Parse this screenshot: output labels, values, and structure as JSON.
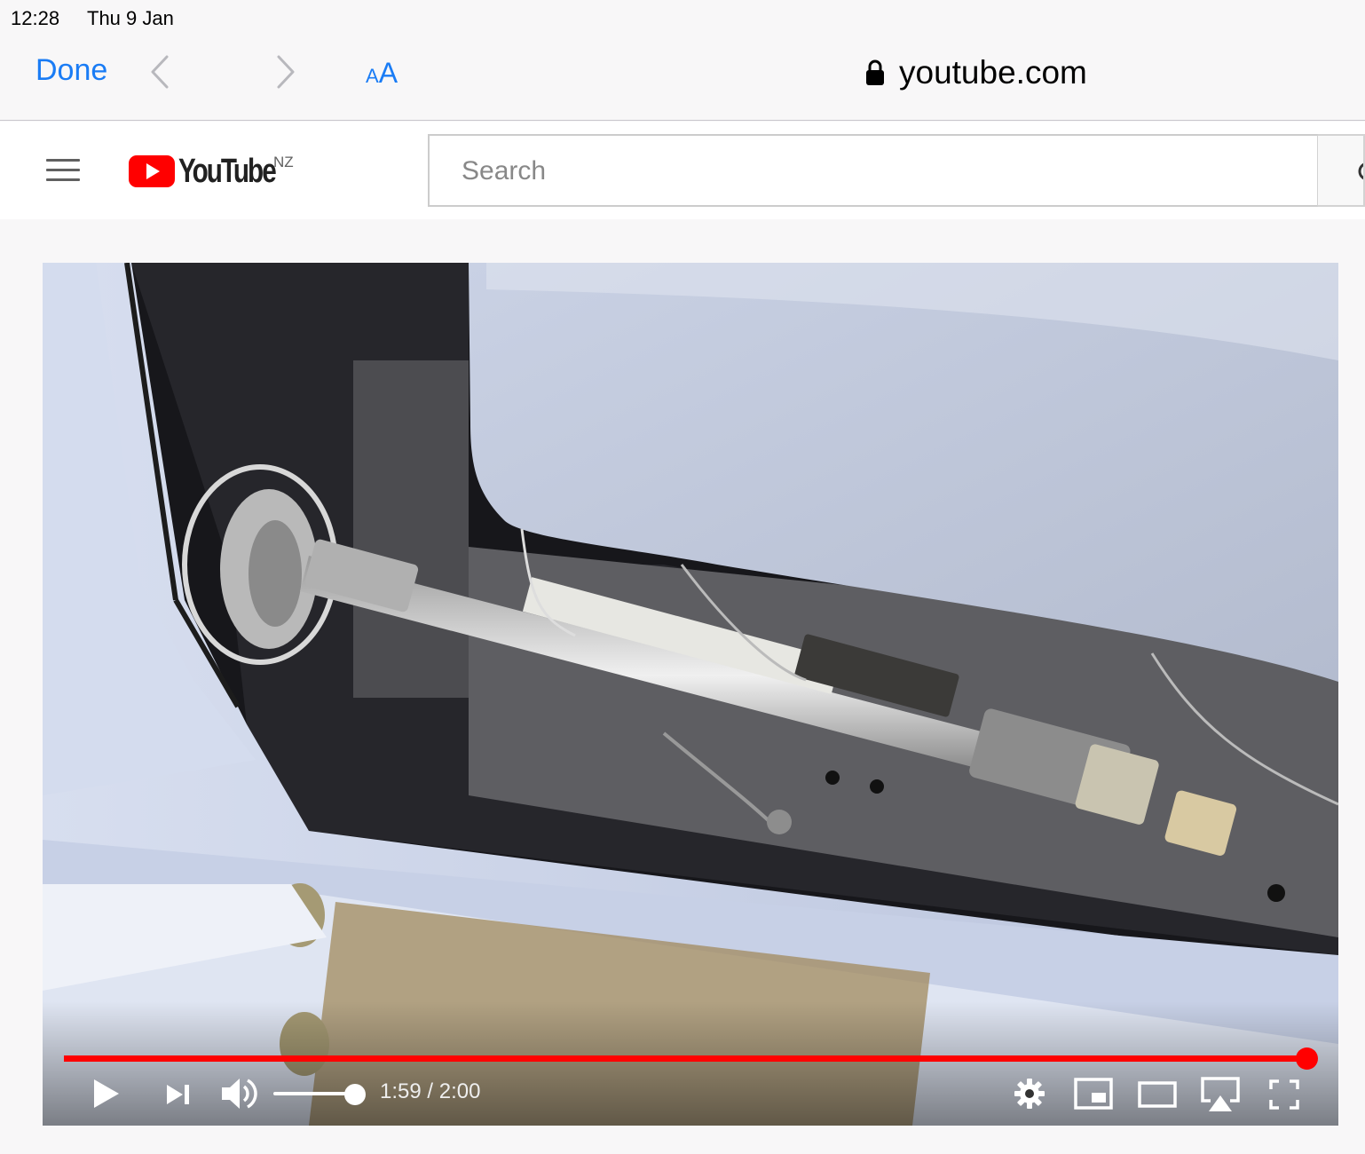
{
  "status_bar": {
    "time": "12:28",
    "date": "Thu 9 Jan"
  },
  "safari": {
    "done_label": "Done",
    "aa_small": "A",
    "aa_big": "A",
    "url": "youtube.com",
    "accent_color": "#1a7cf5"
  },
  "youtube": {
    "logo_text": "YouTube",
    "country_code": "NZ",
    "search_placeholder": "Search",
    "brand_color": "#ff0000"
  },
  "player": {
    "progress_fraction": 0.9917,
    "volume_fraction": 0.9,
    "time_current": "1:59",
    "time_separator": " / ",
    "time_total": "2:00",
    "icons": [
      "play-icon",
      "next-icon",
      "volume-icon",
      "settings-icon",
      "miniplayer-icon",
      "theater-mode-icon",
      "airplay-icon",
      "fullscreen-icon"
    ]
  }
}
